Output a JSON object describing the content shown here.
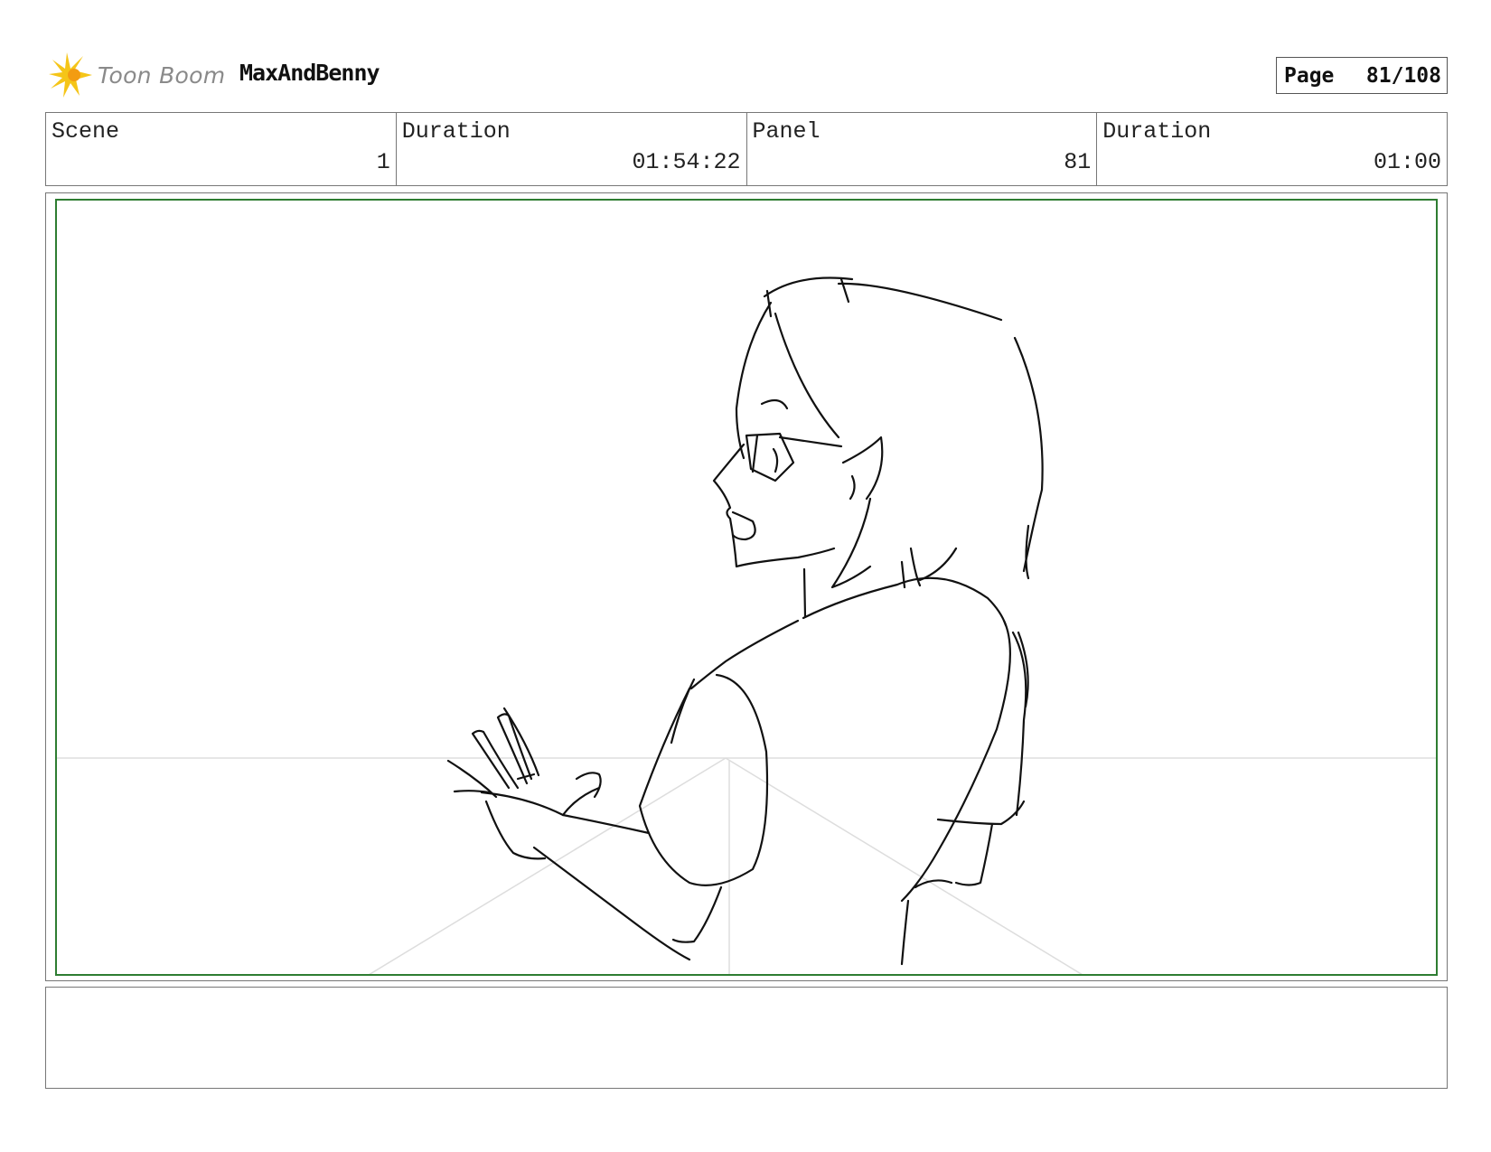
{
  "header": {
    "logo_text": "Toon Boom",
    "logo_icon": "toon-boom-starburst-icon",
    "project_name": "MaxAndBenny",
    "page_label": "Page",
    "page_number": "81/108"
  },
  "info": [
    {
      "label": "Scene",
      "value": "1"
    },
    {
      "label": "Duration",
      "value": "01:54:22"
    },
    {
      "label": "Panel",
      "value": "81"
    },
    {
      "label": "Duration",
      "value": "01:00"
    }
  ],
  "colors": {
    "frame_border": "#2e7d32",
    "logo_yellow": "#f5c518",
    "logo_orange": "#f39c12",
    "sketch_line": "#111111",
    "guide_line": "#dddddd"
  },
  "notes": ""
}
